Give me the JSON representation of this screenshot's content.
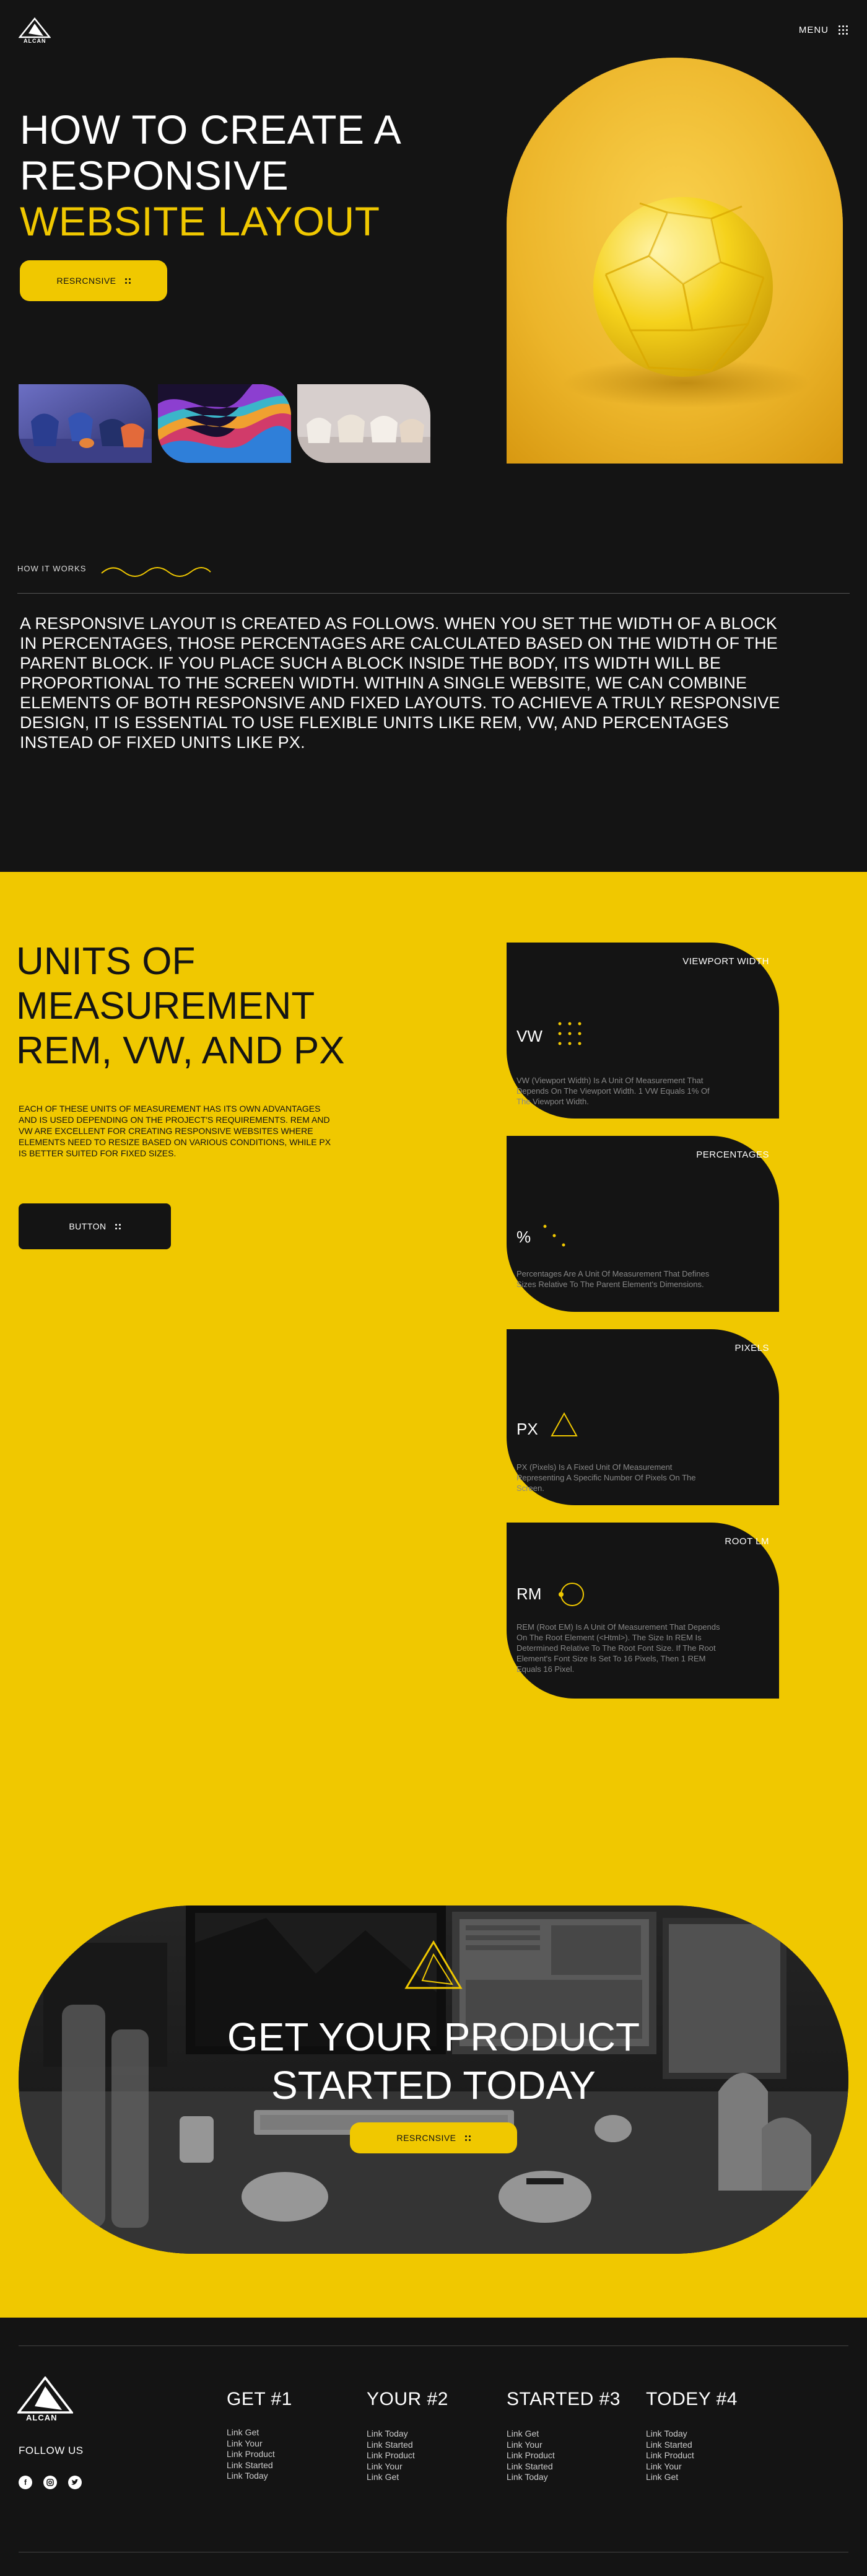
{
  "header": {
    "logo_text": "ALCAN",
    "menu_label": "MENU"
  },
  "hero": {
    "title_line1": "HOW TO CREATE A",
    "title_line2": "RESPONSIVE",
    "title_line3": "WEBSITE LAYOUT",
    "button_label": "RESRCNSIVE",
    "thumbnails": [
      "blue-chairs-image",
      "colorful-waves-image",
      "white-chairs-image"
    ],
    "feature_image": "yellow-polyhedron-image"
  },
  "how_it_works": {
    "label": "HOW IT WORKS",
    "text": "A RESPONSIVE LAYOUT IS CREATED AS FOLLOWS. WHEN YOU SET THE WIDTH OF A BLOCK IN PERCENTAGES, THOSE PERCENTAGES ARE CALCULATED BASED ON THE WIDTH OF THE PARENT BLOCK. IF YOU PLACE SUCH A BLOCK INSIDE THE BODY, ITS WIDTH WILL BE PROPORTIONAL TO THE SCREEN WIDTH. WITHIN A SINGLE WEBSITE, WE CAN COMBINE ELEMENTS OF BOTH RESPONSIVE AND FIXED LAYOUTS. TO ACHIEVE A TRULY RESPONSIVE DESIGN, IT IS ESSENTIAL TO USE FLEXIBLE UNITS LIKE REM, VW, AND PERCENTAGES INSTEAD OF FIXED UNITS LIKE PX."
  },
  "units": {
    "title_line1": "UNITS OF",
    "title_line2": "MEASUREMENT",
    "title_line3": "REM, VW, AND PX",
    "description": "EACH OF THESE UNITS OF MEASUREMENT HAS ITS OWN ADVANTAGES AND IS USED DEPENDING ON THE PROJECT'S REQUIREMENTS. REM AND VW ARE EXCELLENT FOR CREATING RESPONSIVE WEBSITES WHERE ELEMENTS NEED TO RESIZE BASED ON VARIOUS CONDITIONS, WHILE PX IS BETTER SUITED FOR FIXED SIZES.",
    "button_label": "BUTTON",
    "cards": [
      {
        "label": "VIEWPORT WIDTH",
        "abbr": "VW",
        "text": "VW (Viewport Width) Is A Unit Of Measurement That Depends On The Viewport Width. 1 VW Equals 1% Of The Viewport Width.",
        "icon": "dot-grid-icon"
      },
      {
        "label": "PERCENTAGES",
        "abbr": "%",
        "text": "Percentages Are A Unit Of Measurement That Defines Sizes Relative To The Parent Element's Dimensions.",
        "icon": "diagonal-dots-icon"
      },
      {
        "label": "PIXELS",
        "abbr": "PX",
        "text": "PX (Pixels) Is A Fixed Unit Of Measurement Representing A Specific Number Of Pixels On The Screen.",
        "icon": "triangle-icon"
      },
      {
        "label": "ROOT LM",
        "abbr": "RM",
        "text": "REM (Root EM) Is A Unit Of Measurement That Depends On The Root Element (<Html>). The Size In REM Is Determined Relative To The Root Font Size. If The Root Element's Font Size Is Set To 16 Pixels, Then 1 REM Equals 16 Pixel.",
        "icon": "circle-dot-icon"
      }
    ]
  },
  "cta": {
    "title_line1": "GET YOUR PRODUCT",
    "title_line2": "STARTED TODAY",
    "button_label": "RESRCNSIVE",
    "background_image": "desk-workspace-image"
  },
  "footer": {
    "logo_text": "ALCAN",
    "follow_label": "FOLLOW US",
    "social": [
      "facebook-icon",
      "instagram-icon",
      "twitter-icon"
    ],
    "columns": [
      {
        "title": "GET #1",
        "links": [
          "Link Get",
          "Link Your",
          "Link Product",
          "Link Started",
          "Link Today"
        ]
      },
      {
        "title": "YOUR #2",
        "links": [
          "Link Today",
          "Link Started",
          "Link Product",
          "Link Your",
          "Link Get"
        ]
      },
      {
        "title": "STARTED #3",
        "links": [
          "Link Get",
          "Link Your",
          "Link Product",
          "Link Started",
          "Link Today"
        ]
      },
      {
        "title": "TODEY #4",
        "links": [
          "Link Today",
          "Link Started",
          "Link Product",
          "Link Your",
          "Link Get"
        ]
      }
    ]
  },
  "colors": {
    "accent": "#f0c800",
    "background": "#141414",
    "text": "#ffffff"
  }
}
